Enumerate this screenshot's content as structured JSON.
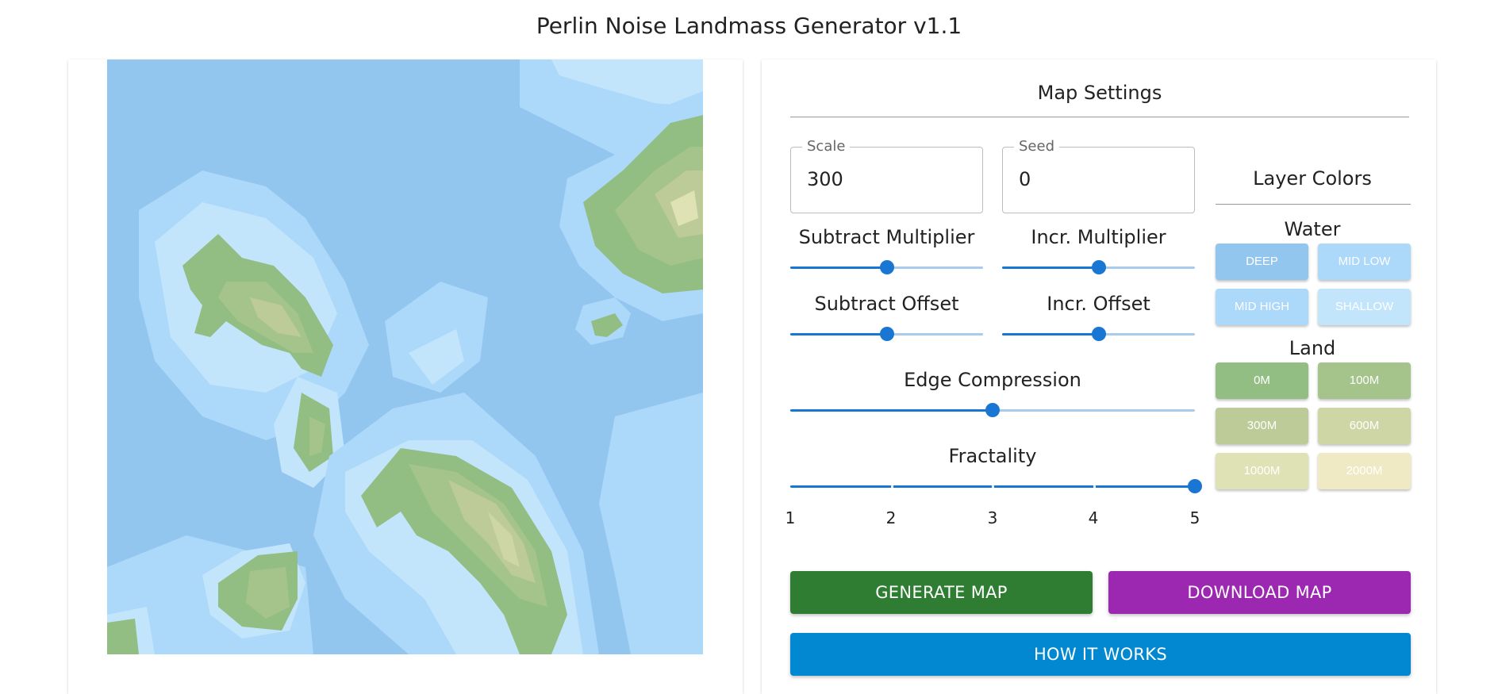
{
  "app": {
    "title": "Perlin Noise Landmass Generator v1.1"
  },
  "settings": {
    "title": "Map Settings",
    "scale": {
      "label": "Scale",
      "value": "300"
    },
    "seed": {
      "label": "Seed",
      "value": "0"
    },
    "subtract_multiplier": {
      "label": "Subtract Multiplier",
      "value": 0.5
    },
    "incr_multiplier": {
      "label": "Incr. Multiplier",
      "value": 0.5
    },
    "subtract_offset": {
      "label": "Subtract Offset",
      "value": 0.5
    },
    "incr_offset": {
      "label": "Incr. Offset",
      "value": 0.5
    },
    "edge_compression": {
      "label": "Edge Compression",
      "value": 0.5
    },
    "fractality": {
      "label": "Fractality",
      "value": 5,
      "marks": [
        "1",
        "2",
        "3",
        "4",
        "5"
      ]
    }
  },
  "layers": {
    "title": "Layer Colors",
    "water_title": "Water",
    "land_title": "Land",
    "water": [
      {
        "label": "DEEP",
        "color": "#93c6ef"
      },
      {
        "label": "MID LOW",
        "color": "#acd8fa"
      },
      {
        "label": "MID HIGH",
        "color": "#acd8fa"
      },
      {
        "label": "SHALLOW",
        "color": "#c2e5fc"
      }
    ],
    "land": [
      {
        "label": "0M",
        "color": "#92be84"
      },
      {
        "label": "100M",
        "color": "#a5c48c"
      },
      {
        "label": "300M",
        "color": "#bccb97"
      },
      {
        "label": "600M",
        "color": "#cfd6a6"
      },
      {
        "label": "1000M",
        "color": "#dfe2b5"
      },
      {
        "label": "2000M",
        "color": "#efeac4"
      }
    ]
  },
  "actions": {
    "generate": {
      "label": "GENERATE MAP",
      "color": "#2e7d32"
    },
    "download": {
      "label": "DOWNLOAD MAP",
      "color": "#9c27b0"
    },
    "how": {
      "label": "HOW IT WORKS",
      "color": "#0288d1"
    }
  },
  "colors": {
    "slider": "#1976d2",
    "slider_rail": "#a9cbee"
  }
}
